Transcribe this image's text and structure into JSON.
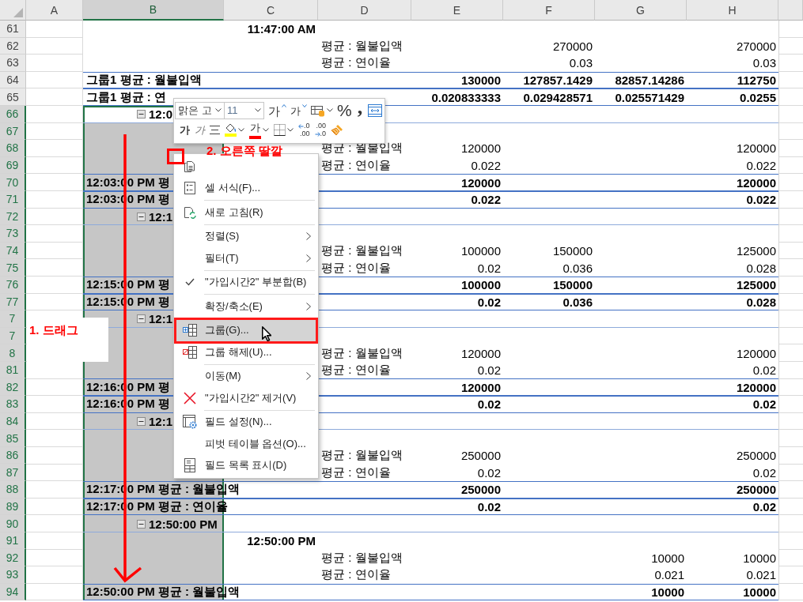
{
  "sheet": {
    "columns": [
      {
        "label": "A",
        "selected": false
      },
      {
        "label": "B",
        "selected": true
      },
      {
        "label": "C",
        "selected": false
      },
      {
        "label": "D",
        "selected": false
      },
      {
        "label": "E",
        "selected": false
      },
      {
        "label": "F",
        "selected": false
      },
      {
        "label": "G",
        "selected": false
      },
      {
        "label": "H",
        "selected": false
      }
    ],
    "rows": [
      {
        "number": "61",
        "kind": "time",
        "selected": false,
        "cells": {
          "C": "11:47:00 AM"
        }
      },
      {
        "number": "62",
        "kind": "detail",
        "selected": false,
        "cells": {
          "D": "평균 : 월불입액",
          "F": "270000",
          "H": "270000"
        }
      },
      {
        "number": "63",
        "kind": "detail",
        "selected": false,
        "cells": {
          "D": "평균 : 연이율",
          "F": "0.03",
          "H": "0.03"
        }
      },
      {
        "number": "64",
        "kind": "subtotal",
        "selected": false,
        "cells": {
          "B": "그룹1 평균 : 월불입액",
          "E": "130000",
          "F": "127857.1429",
          "G": "82857.14286",
          "H": "112750"
        }
      },
      {
        "number": "65",
        "kind": "subtotal",
        "selected": false,
        "cells": {
          "B": "그룹1 평균 : 연",
          "E": "0.020833333",
          "F": "0.029428571",
          "G": "0.025571429",
          "H": "0.0255"
        }
      },
      {
        "number": "66",
        "kind": "group",
        "selected": true,
        "cells": {
          "B": "12:0"
        }
      },
      {
        "number": "67",
        "kind": "blank",
        "selected": true
      },
      {
        "number": "68",
        "kind": "detail",
        "selected": true,
        "cells": {
          "D": "평균 : 월불입액",
          "E": "120000",
          "H": "120000"
        }
      },
      {
        "number": "69",
        "kind": "detail",
        "selected": true,
        "cells": {
          "D": "평균 : 연이율",
          "E": "0.022",
          "H": "0.022"
        }
      },
      {
        "number": "70",
        "kind": "subtotal",
        "selected": true,
        "cells": {
          "B": "12:03:00 PM 평",
          "E": "120000",
          "H": "120000"
        }
      },
      {
        "number": "71",
        "kind": "subtotal",
        "selected": true,
        "cells": {
          "B": "12:03:00 PM 평",
          "E": "0.022",
          "H": "0.022"
        }
      },
      {
        "number": "72",
        "kind": "group",
        "selected": true,
        "cells": {
          "B": "12:1"
        }
      },
      {
        "number": "73",
        "kind": "blank",
        "selected": true
      },
      {
        "number": "74",
        "kind": "detail",
        "selected": true,
        "cells": {
          "D": "평균 : 월불입액",
          "E": "100000",
          "F": "150000",
          "H": "125000"
        }
      },
      {
        "number": "75",
        "kind": "detail",
        "selected": true,
        "cells": {
          "D": "평균 : 연이율",
          "E": "0.02",
          "F": "0.036",
          "H": "0.028"
        }
      },
      {
        "number": "76",
        "kind": "subtotal",
        "selected": true,
        "cells": {
          "B": "12:15:00 PM 평",
          "E": "100000",
          "F": "150000",
          "H": "125000"
        }
      },
      {
        "number": "77",
        "kind": "subtotal",
        "selected": true,
        "cells": {
          "B": "12:15:00 PM 평",
          "E": "0.02",
          "F": "0.036",
          "H": "0.028"
        }
      },
      {
        "number": "7",
        "kind": "group",
        "selected": true,
        "cells": {
          "B": "12:1"
        }
      },
      {
        "number": "7",
        "kind": "blank",
        "selected": true
      },
      {
        "number": "8",
        "kind": "detail",
        "selected": true,
        "cells": {
          "D": "평균 : 월불입액",
          "E": "120000",
          "H": "120000"
        }
      },
      {
        "number": "81",
        "kind": "detail",
        "selected": true,
        "cells": {
          "D": "평균 : 연이율",
          "E": "0.02",
          "H": "0.02"
        }
      },
      {
        "number": "82",
        "kind": "subtotal",
        "selected": true,
        "cells": {
          "B": "12:16:00 PM 평",
          "E": "120000",
          "H": "120000"
        }
      },
      {
        "number": "83",
        "kind": "subtotal",
        "selected": true,
        "cells": {
          "B": "12:16:00 PM 평",
          "E": "0.02",
          "H": "0.02"
        }
      },
      {
        "number": "84",
        "kind": "group",
        "selected": true,
        "cells": {
          "B": "12:1"
        }
      },
      {
        "number": "85",
        "kind": "blank",
        "selected": true
      },
      {
        "number": "86",
        "kind": "detail",
        "selected": true,
        "cells": {
          "D": "평균 : 월불입액",
          "E": "250000",
          "H": "250000"
        }
      },
      {
        "number": "87",
        "kind": "detail",
        "selected": true,
        "cells": {
          "D": "평균 : 연이율",
          "E": "0.02",
          "H": "0.02"
        }
      },
      {
        "number": "88",
        "kind": "subtotal",
        "selected": true,
        "cells": {
          "B": "12:17:00 PM 평균 : 월불입액",
          "E": "250000",
          "H": "250000"
        }
      },
      {
        "number": "89",
        "kind": "subtotal",
        "selected": true,
        "cells": {
          "B": "12:17:00 PM 평균 : 연이율",
          "E": "0.02",
          "H": "0.02"
        }
      },
      {
        "number": "90",
        "kind": "group",
        "selected": true,
        "cells": {
          "B": "12:50:00 PM"
        }
      },
      {
        "number": "91",
        "kind": "time",
        "selected": true,
        "cells": {
          "C": "12:50:00 PM"
        }
      },
      {
        "number": "92",
        "kind": "detail",
        "selected": true,
        "cells": {
          "D": "평균 : 월불입액",
          "G": "10000",
          "H": "10000"
        }
      },
      {
        "number": "93",
        "kind": "detail",
        "selected": true,
        "cells": {
          "D": "평균 : 연이율",
          "G": "0.021",
          "H": "0.021"
        }
      },
      {
        "number": "94",
        "kind": "subtotal",
        "selected": true,
        "cells": {
          "B": "12:50:00 PM 평균 : 월불입액",
          "G": "10000",
          "H": "10000"
        }
      }
    ]
  },
  "mini_toolbar": {
    "font_name": "맑은 고",
    "font_size": "11",
    "rows": [
      [
        {
          "kind": "grow-font",
          "label": "가",
          "dropdown": false
        },
        {
          "kind": "shrink-font",
          "label": "가",
          "dropdown": false
        },
        {
          "kind": "number-format",
          "dropdown": true
        },
        {
          "kind": "percent",
          "label": "%",
          "dropdown": false
        },
        {
          "kind": "comma",
          "label": ",",
          "dropdown": false
        },
        {
          "kind": "wrap",
          "dropdown": false
        }
      ],
      [
        {
          "kind": "bold",
          "label": "가",
          "dropdown": false
        },
        {
          "kind": "italic",
          "label": "가",
          "dropdown": false
        },
        {
          "kind": "align",
          "dropdown": false
        },
        {
          "kind": "fill-color",
          "color": "#ffff00",
          "dropdown": true
        },
        {
          "kind": "font-color",
          "label": "가",
          "color": "#ff0000",
          "dropdown": true
        },
        {
          "kind": "borders",
          "dropdown": true
        },
        {
          "kind": "increase-decimal",
          "lines": [
            ".0",
            ".00"
          ],
          "dropdown": false
        },
        {
          "kind": "decrease-decimal",
          "lines": [
            ".00",
            ".0"
          ],
          "dropdown": false
        },
        {
          "kind": "format-painter",
          "dropdown": false
        }
      ]
    ]
  },
  "context_menu": {
    "items": [
      {
        "kind": "item",
        "checked": false,
        "submenu": false,
        "selected": false,
        "outlined": false
      },
      {
        "kind": "item",
        "label": "셀 서식(F)...",
        "checked": false,
        "submenu": false,
        "selected": false,
        "outlined": false
      },
      {
        "kind": "separator"
      },
      {
        "kind": "item",
        "label": "새로 고침(R)",
        "checked": false,
        "submenu": false,
        "selected": false,
        "outlined": false
      },
      {
        "kind": "separator"
      },
      {
        "kind": "item",
        "label": "정렬(S)",
        "checked": false,
        "submenu": true,
        "selected": false,
        "outlined": false
      },
      {
        "kind": "item",
        "label": "필터(T)",
        "checked": false,
        "submenu": true,
        "selected": false,
        "outlined": false
      },
      {
        "kind": "separator"
      },
      {
        "kind": "item",
        "label": "\"가입시간2\" 부분합(B)",
        "checked": true,
        "submenu": false,
        "selected": false,
        "outlined": false
      },
      {
        "kind": "separator"
      },
      {
        "kind": "item",
        "label": "확장/축소(E)",
        "checked": false,
        "submenu": true,
        "selected": false,
        "outlined": false
      },
      {
        "kind": "separator"
      },
      {
        "kind": "item",
        "label": "그룹(G)...",
        "checked": false,
        "submenu": false,
        "selected": true,
        "outlined": true
      },
      {
        "kind": "item",
        "label": "그룹 해제(U)...",
        "checked": false,
        "submenu": false,
        "selected": false,
        "outlined": false
      },
      {
        "kind": "separator"
      },
      {
        "kind": "item",
        "label": "이동(M)",
        "checked": false,
        "submenu": true,
        "selected": false,
        "outlined": false
      },
      {
        "kind": "item",
        "label": "\"가입시간2\" 제거(V)",
        "checked": false,
        "submenu": false,
        "selected": false,
        "outlined": false
      },
      {
        "kind": "separator"
      },
      {
        "kind": "item",
        "label": "필드 설정(N)...",
        "checked": false,
        "submenu": false,
        "selected": false,
        "outlined": false
      },
      {
        "kind": "item",
        "label": "피벗 테이블 옵션(O)...",
        "checked": false,
        "submenu": false,
        "selected": false,
        "outlined": false
      },
      {
        "kind": "item",
        "label": "필드 목록 표시(D)",
        "checked": false,
        "submenu": false,
        "selected": false,
        "outlined": false
      }
    ]
  },
  "annotations": {
    "drag_label": "1. 드래그",
    "click_label": "2. 오른쪽 딸깔"
  }
}
